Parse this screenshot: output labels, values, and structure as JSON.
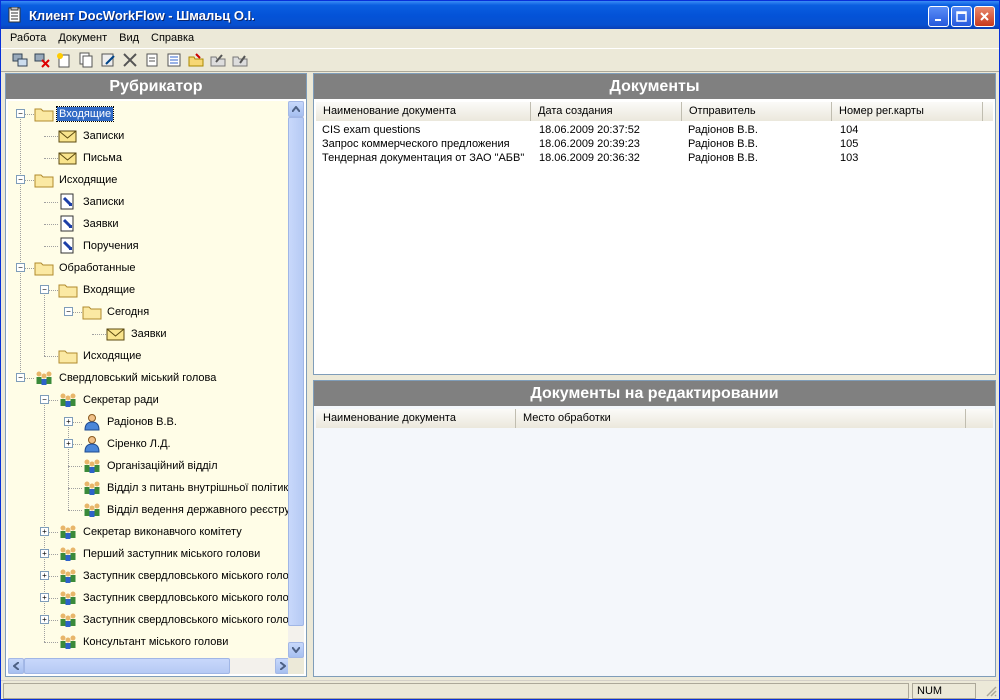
{
  "window": {
    "title": "Клиент DocWorkFlow - Шмальц О.І."
  },
  "menu": [
    "Работа",
    "Документ",
    "Вид",
    "Справка"
  ],
  "toolbar": {
    "buttons": [
      "connect-icon",
      "disconnect-icon",
      "new-document-icon",
      "copy-document-icon",
      "edit-document-icon",
      "tools-icon",
      "properties-icon",
      "list-icon",
      "folder-open-icon",
      "folder-send-icon",
      "folder-export-icon"
    ]
  },
  "left": {
    "header": "Рубрикатор",
    "tree": [
      {
        "label": "Входящие",
        "icon": "folder-icon",
        "level": 0,
        "expander": "minus",
        "selected": true
      },
      {
        "label": "Записки",
        "icon": "envelope-icon",
        "level": 1
      },
      {
        "label": "Письма",
        "icon": "envelope-icon",
        "level": 1
      },
      {
        "label": "Исходящие",
        "icon": "folder-icon",
        "level": 0,
        "expander": "minus"
      },
      {
        "label": "Записки",
        "icon": "document-icon",
        "level": 1
      },
      {
        "label": "Заявки",
        "icon": "document-icon",
        "level": 1
      },
      {
        "label": "Поручения",
        "icon": "document-icon",
        "level": 1
      },
      {
        "label": "Обработанные",
        "icon": "folder-icon",
        "level": 0,
        "expander": "minus"
      },
      {
        "label": "Входящие",
        "icon": "folder-icon",
        "level": 1,
        "expander": "minus"
      },
      {
        "label": "Сегодня",
        "icon": "folder-icon",
        "level": 2,
        "expander": "minus"
      },
      {
        "label": "Заявки",
        "icon": "envelope-icon",
        "level": 3
      },
      {
        "label": "Исходящие",
        "icon": "folder-icon",
        "level": 1
      },
      {
        "label": "Свердловський міський голова",
        "icon": "group-icon",
        "level": 0,
        "expander": "minus"
      },
      {
        "label": "Секретар ради",
        "icon": "group-icon",
        "level": 1,
        "expander": "minus"
      },
      {
        "label": "Радіонов В.В.",
        "icon": "person-icon",
        "level": 2,
        "expander": "plus"
      },
      {
        "label": "Сіренко  Л.Д.",
        "icon": "person-icon",
        "level": 2,
        "expander": "plus"
      },
      {
        "label": "Організаційний відділ",
        "icon": "group-icon",
        "level": 2
      },
      {
        "label": "Відділ з питань внутрішньої політики",
        "icon": "group-icon",
        "level": 2
      },
      {
        "label": "Відділ ведення державного реєстру",
        "icon": "group-icon",
        "level": 2
      },
      {
        "label": "Секретар виконавчого комітету",
        "icon": "group-icon",
        "level": 1,
        "expander": "plus"
      },
      {
        "label": "Перший заступник міського голови",
        "icon": "group-icon",
        "level": 1,
        "expander": "plus"
      },
      {
        "label": "Заступник свердловського міського голови",
        "icon": "group-icon",
        "level": 1,
        "expander": "plus"
      },
      {
        "label": "Заступник свердловського міського голови",
        "icon": "group-icon",
        "level": 1,
        "expander": "plus"
      },
      {
        "label": "Заступник свердловського міського голови",
        "icon": "group-icon",
        "level": 1,
        "expander": "plus"
      },
      {
        "label": "Консультант міського голови",
        "icon": "group-icon",
        "level": 1
      }
    ]
  },
  "documents": {
    "header": "Документы",
    "columns": [
      "Наименование документа",
      "Дата создания",
      "Отправитель",
      "Номер рег.карты"
    ],
    "rows": [
      [
        "CIS exam questions",
        "18.06.2009 20:37:52",
        "Радіонов В.В.",
        "104"
      ],
      [
        "Запрос коммерческого предложения",
        "18.06.2009 20:39:23",
        "Радіонов В.В.",
        "105"
      ],
      [
        "Тендерная документация от ЗАО \"АБВ\"",
        "18.06.2009 20:36:32",
        "Радіонов В.В.",
        "103"
      ]
    ]
  },
  "editing": {
    "header": "Документы на редактировании",
    "columns": [
      "Наименование документа",
      "Место обработки"
    ]
  },
  "status": {
    "num": "NUM"
  }
}
